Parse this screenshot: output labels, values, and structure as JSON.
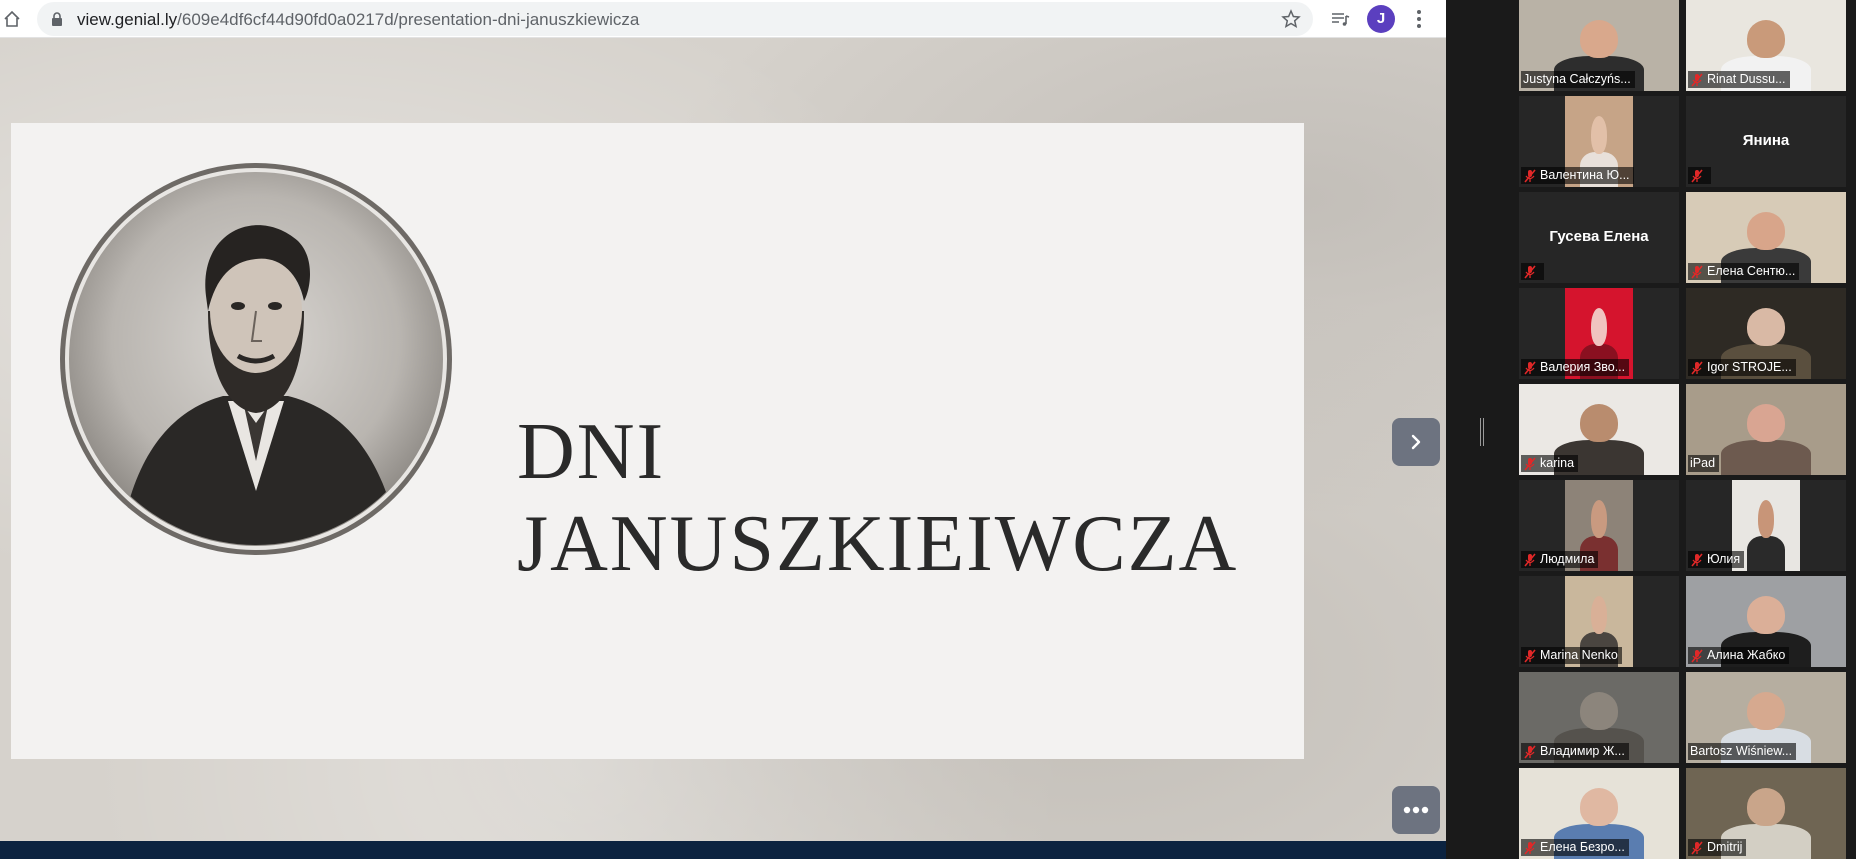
{
  "browser": {
    "url_host": "view.genial.ly",
    "url_path": "/609e4df6cf44d90fd0a0217d/presentation-dni-januszkiewicza",
    "profile_initial": "J"
  },
  "slide": {
    "title_line1": "DNI",
    "title_line2": "JANUSZKIEIWCZA"
  },
  "participants": [
    {
      "name": "Justyna Całczyńs...",
      "muted": false,
      "video": true,
      "active": true,
      "bg": "#b9b2a6",
      "skin": "#d9a88c",
      "shirt": "#2d2d2d"
    },
    {
      "name": "Rinat Dussu...",
      "muted": true,
      "video": true,
      "active": false,
      "bg": "#e9e6df",
      "skin": "#c99a7a",
      "shirt": "#f2f2f2"
    },
    {
      "name": "Валентина Ю...",
      "muted": true,
      "video": true,
      "narrow": true,
      "bg": "#c6a487",
      "skin": "#e2c0a8",
      "shirt": "#e8e0da"
    },
    {
      "name": "Янина",
      "muted": true,
      "video": false
    },
    {
      "name": "Гусева Елена",
      "muted": true,
      "video": false
    },
    {
      "name": "Елена Сентю...",
      "muted": true,
      "video": true,
      "bg": "#d7cbb7",
      "skin": "#d8a58a",
      "shirt": "#3a3a3a"
    },
    {
      "name": "Валерия Зво...",
      "muted": true,
      "video": true,
      "narrow": true,
      "bg": "#d5142d",
      "skin": "#f0c4c0",
      "shirt": "#8a1020"
    },
    {
      "name": "Igor STROJE...",
      "muted": true,
      "video": true,
      "bg": "#2e2a24",
      "skin": "#d9b9a5",
      "shirt": "#5a4f3e"
    },
    {
      "name": "karina",
      "muted": true,
      "video": true,
      "bg": "#ebe8e4",
      "skin": "#b98c6e",
      "shirt": "#3b3632"
    },
    {
      "name": "iPad",
      "muted": false,
      "video": true,
      "bg": "#a89c8a",
      "skin": "#d9a592",
      "shirt": "#6d5a4f"
    },
    {
      "name": "Людмила",
      "muted": true,
      "video": true,
      "narrow": true,
      "bg": "#8d8378",
      "skin": "#c99a80",
      "shirt": "#7a3030"
    },
    {
      "name": "Юлия",
      "muted": true,
      "video": true,
      "narrow": true,
      "bg": "#e8e6e2",
      "skin": "#c89578",
      "shirt": "#2a2a2a"
    },
    {
      "name": "Marina Nenko",
      "muted": true,
      "video": true,
      "narrow": true,
      "bg": "#c9b79c",
      "skin": "#d9b097",
      "shirt": "#4a4540"
    },
    {
      "name": "Алина Жабко",
      "muted": true,
      "video": true,
      "bg": "#9ea0a3",
      "skin": "#dbaf98",
      "shirt": "#1e1e1e"
    },
    {
      "name": "Владимир Ж...",
      "muted": true,
      "video": true,
      "bg": "#6b6a66",
      "skin": "#8c857c",
      "shirt": "#55524d"
    },
    {
      "name": "Bartosz Wiśniew...",
      "muted": false,
      "video": true,
      "bg": "#b6aea0",
      "skin": "#d6a98f",
      "shirt": "#d8dde3"
    },
    {
      "name": "Елена Безро...",
      "muted": true,
      "video": true,
      "bg": "#e6e2d8",
      "skin": "#e0b8a2",
      "shirt": "#5a7db0"
    },
    {
      "name": "Dmitrij",
      "muted": true,
      "video": true,
      "bg": "#6f6553",
      "skin": "#c9a58a",
      "shirt": "#d3cfc4"
    }
  ],
  "icons": {
    "home": "home-icon",
    "lock": "lock-icon",
    "star": "star-icon",
    "media": "media-control-icon",
    "menu": "kebab-menu-icon",
    "next": "chevron-right-icon",
    "options": "more-dots-icon",
    "mic": "mic-muted-icon"
  },
  "colors": {
    "active_speaker_border": "#c9e265",
    "mute_red": "#e02828",
    "slide_button": "#6d7380"
  }
}
